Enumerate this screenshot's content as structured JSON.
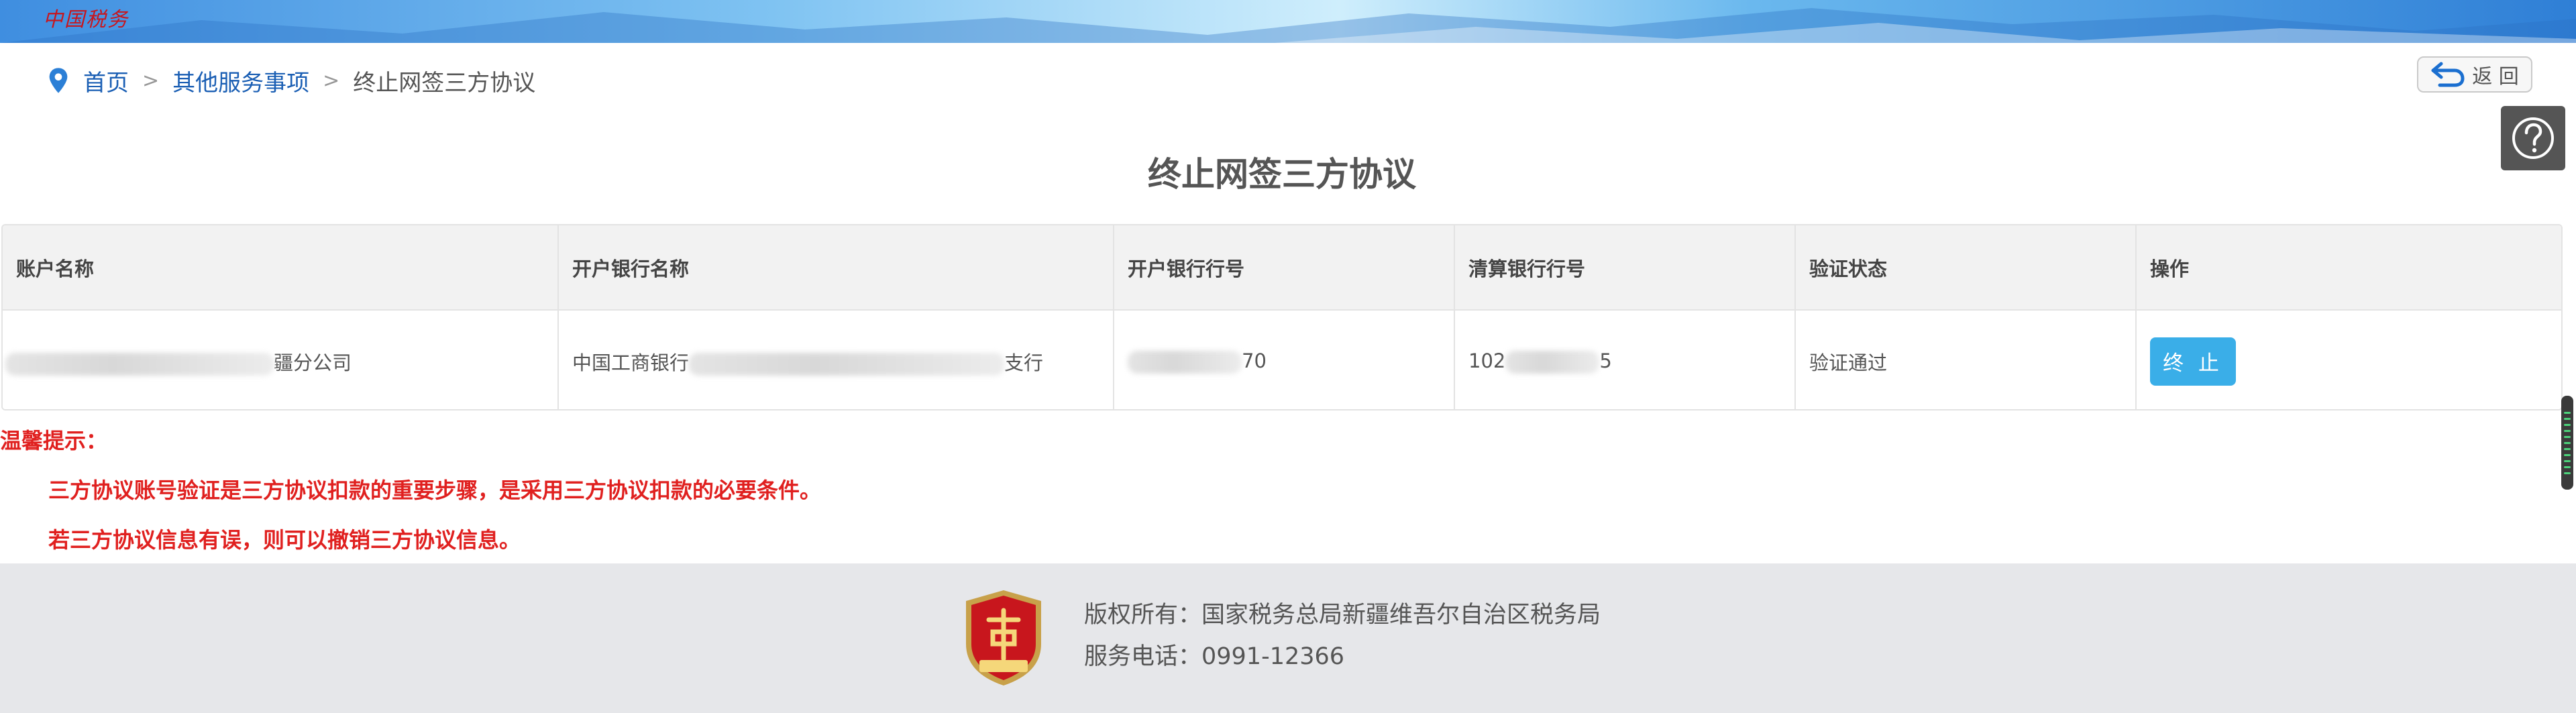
{
  "header": {
    "logo_text": "中国税务"
  },
  "breadcrumb": {
    "home": "首页",
    "separator": ">",
    "parent": "其他服务事项",
    "current": "终止网签三方协议"
  },
  "toolbar": {
    "back_label": "返 回",
    "help_icon": "help-icon"
  },
  "page": {
    "title": "终止网签三方协议"
  },
  "table": {
    "headers": [
      "账户名称",
      "开户银行名称",
      "开户银行行号",
      "清算银行行号",
      "验证状态",
      "操作"
    ],
    "rows": [
      {
        "account_name_suffix": "疆分公司",
        "bank_name_prefix": "中国工商银行",
        "bank_name_suffix": "支行",
        "bank_code_suffix": "70",
        "clearing_code_prefix": "102",
        "clearing_code_suffix": "5",
        "status": "验证通过",
        "action_label": "终 止"
      }
    ]
  },
  "tips": {
    "title": "温馨提示：",
    "lines": [
      "三方协议账号验证是三方协议扣款的重要步骤，是采用三方协议扣款的必要条件。",
      "若三方协议信息有误，则可以撤销三方协议信息。"
    ]
  },
  "footer": {
    "copyright": "版权所有：国家税务总局新疆维吾尔自治区税务局",
    "phone": "服务电话：0991-12366"
  },
  "colors": {
    "link": "#1b5fb4",
    "warning": "#e0201f",
    "primary_button": "#3aaee8",
    "footer_bg": "#e6e7ea"
  }
}
